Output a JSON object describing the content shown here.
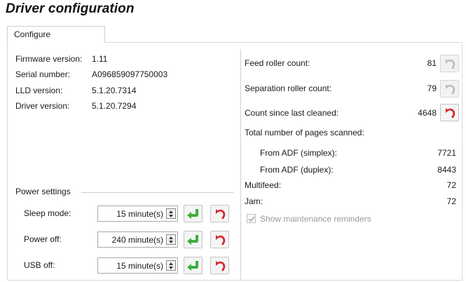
{
  "page": {
    "title": "Driver configuration"
  },
  "tabs": [
    {
      "label": "Configure",
      "active": true
    }
  ],
  "info": {
    "firmware": {
      "label": "Firmware version:",
      "value": "1.11"
    },
    "serial": {
      "label": "Serial number:",
      "value": "A096859097750003"
    },
    "lld": {
      "label": "LLD version:",
      "value": "5.1.20.7314"
    },
    "driver": {
      "label": "Driver version:",
      "value": "5.1.20.7294"
    }
  },
  "power": {
    "group_label": "Power settings",
    "sleep": {
      "label": "Sleep mode:",
      "value": "15 minute(s)"
    },
    "off": {
      "label": "Power off:",
      "value": "240 minute(s)"
    },
    "usb": {
      "label": "USB off:",
      "value": "15 minute(s)"
    }
  },
  "counters": {
    "feed": {
      "label": "Feed roller count:",
      "value": "81"
    },
    "separation": {
      "label": "Separation roller count:",
      "value": "79"
    },
    "cleaned": {
      "label": "Count since last cleaned:",
      "value": "4648"
    },
    "total_label": "Total number of pages scanned:",
    "simplex": {
      "label": "From ADF (simplex):",
      "value": "7721"
    },
    "duplex": {
      "label": "From ADF (duplex):",
      "value": "8443"
    },
    "multifeed": {
      "label": "Multifeed:",
      "value": "72"
    },
    "jam": {
      "label": "Jam:",
      "value": "72"
    }
  },
  "reminders": {
    "label": "Show maintenance reminders",
    "checked": true,
    "enabled": false
  },
  "colors": {
    "apply_green": "#3cae3c",
    "reset_red": "#d9262c",
    "disabled_gray": "#bdbdbd"
  },
  "icons": {
    "apply": "green-check-arrow-icon",
    "reset": "red-undo-arrow-icon"
  }
}
